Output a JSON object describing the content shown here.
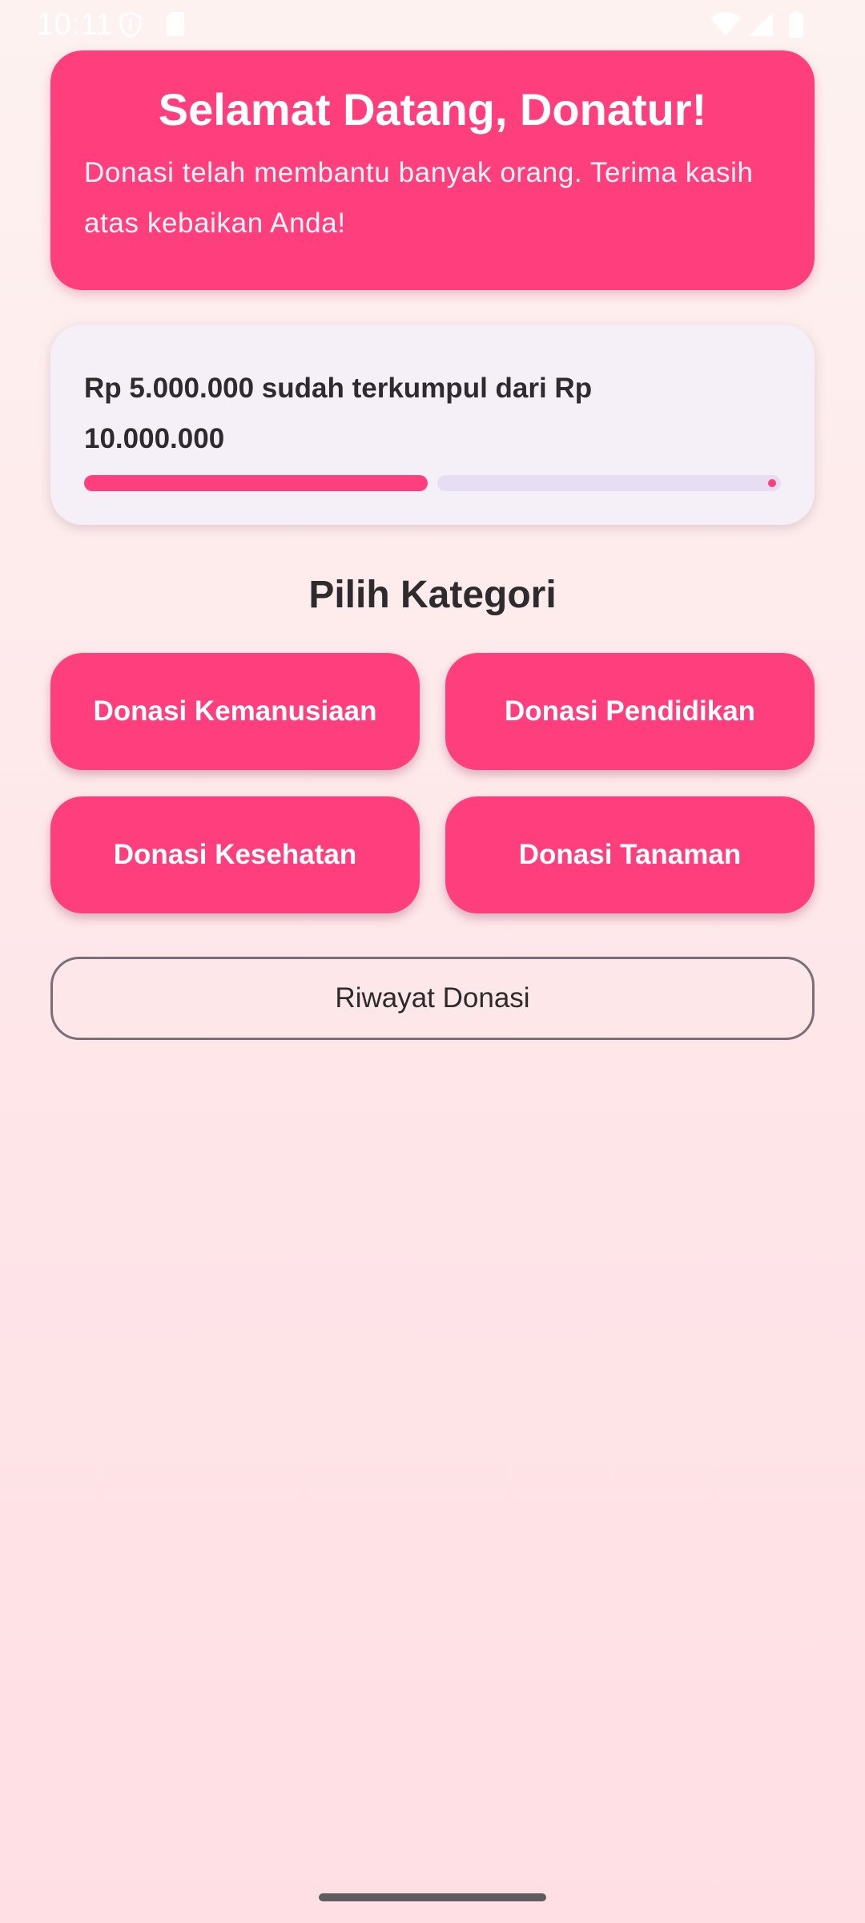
{
  "status_bar": {
    "time": "10:11",
    "icons": [
      "shield-icon",
      "sd-card-icon",
      "wifi-icon",
      "signal-icon",
      "battery-icon"
    ]
  },
  "welcome": {
    "title": "Selamat Datang, Donatur!",
    "subtitle": "Donasi telah membantu banyak orang. Terima kasih atas kebaikan Anda!"
  },
  "progress": {
    "text": "Rp 5.000.000 sudah terkumpul dari Rp 10.000.000",
    "collected": 5000000,
    "target": 10000000,
    "fraction": 0.5
  },
  "categories": {
    "title": "Pilih Kategori",
    "items": [
      {
        "label": "Donasi Kemanusiaan"
      },
      {
        "label": "Donasi Pendidikan"
      },
      {
        "label": "Donasi Kesehatan"
      },
      {
        "label": "Donasi Tanaman"
      }
    ]
  },
  "history": {
    "label": "Riwayat Donasi"
  },
  "colors": {
    "accent": "#ff3f7d",
    "card_bg": "#f5f0f8",
    "track": "#e7def4",
    "text": "#2e2b2e"
  }
}
